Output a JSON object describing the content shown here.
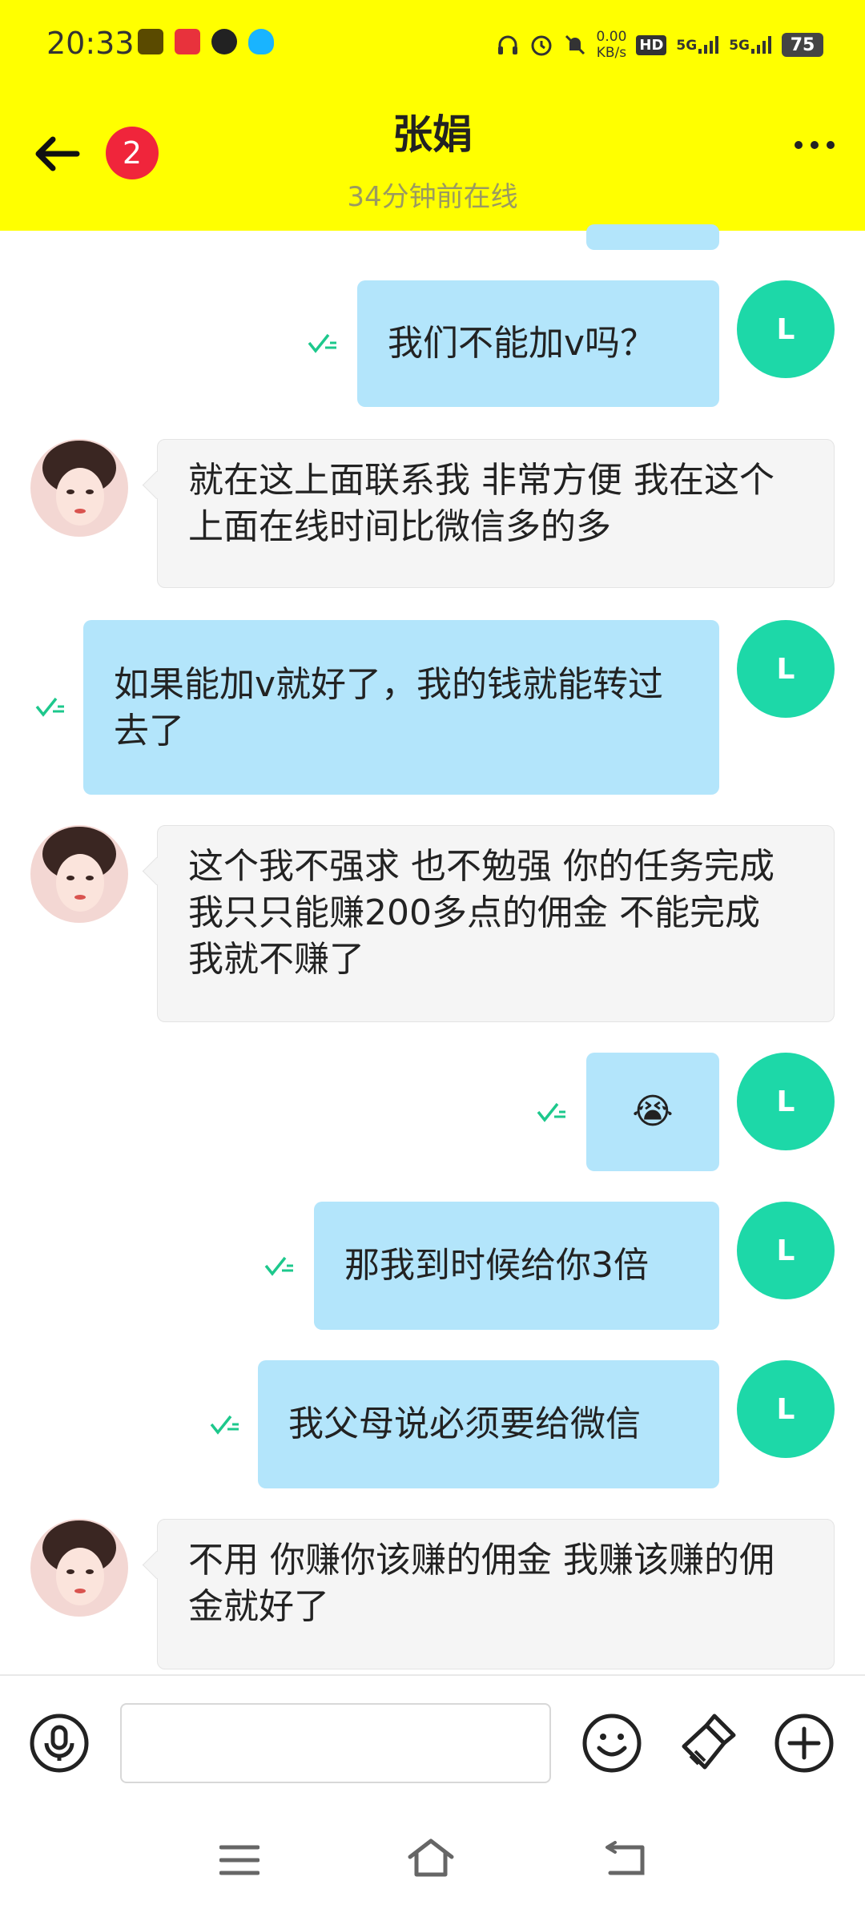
{
  "status_bar": {
    "time": "20:33",
    "net_speed": "0.00\nKB/s",
    "net_speed_top": "0.00",
    "net_speed_unit": "KB/s",
    "hd": "HD",
    "signal_1": "5G",
    "signal_2": "5G",
    "battery": "75"
  },
  "header": {
    "unread_badge": "2",
    "contact_name": "张娟",
    "last_seen": "34分钟前在线",
    "bg_color": "#FFFF00"
  },
  "messages": [
    {
      "side": "sent",
      "text": "我们不能加v吗？",
      "avatar": "L"
    },
    {
      "side": "received",
      "text": "就在这上面联系我  非常方便  我在这个上面在线时间比微信多的多"
    },
    {
      "side": "sent",
      "text": "如果能加v就好了，我的钱就能转过去了",
      "avatar": "L"
    },
    {
      "side": "received",
      "text": "这个我不强求    也不勉强    你的任务完成  我只只能赚200多点的佣金  不能完成  我就不赚了"
    },
    {
      "side": "sent",
      "text": "😭",
      "avatar": "L"
    },
    {
      "side": "sent",
      "text": "那我到时候给你3倍",
      "avatar": "L"
    },
    {
      "side": "sent",
      "text": "我父母说必须要给微信",
      "avatar": "L"
    },
    {
      "side": "received",
      "text": "不用  你赚你该赚的佣金 我赚该赚的佣金就好了"
    }
  ],
  "input_bar": {
    "message_placeholder": "",
    "icons": [
      "microphone-icon",
      "emoji-icon",
      "brush-icon",
      "plus-icon"
    ]
  },
  "colors": {
    "sent_bubble": "#B3E5FB",
    "received_bubble": "#F5F5F5",
    "avatar_accent": "#1DD8A8",
    "read_tick": "#1DC88C"
  }
}
